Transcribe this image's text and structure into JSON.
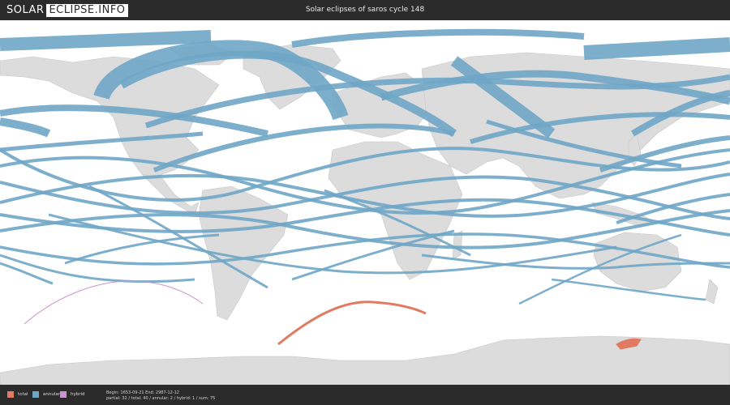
{
  "header": {
    "logo_part1": "SOLAR",
    "logo_part2": "ECLIPSE.INFO",
    "title": "Solar eclipses of saros cycle 148"
  },
  "colors": {
    "total": "#e07b62",
    "annular": "#6fa6c6",
    "hybrid": "#c994cc",
    "land": "#dcdcdc",
    "bar": "#2b2b2b"
  },
  "legend": [
    {
      "label": "total",
      "color": "#e07b62"
    },
    {
      "label": "annular",
      "color": "#6fa6c6"
    },
    {
      "label": "hybrid",
      "color": "#c994cc"
    }
  ],
  "footer": {
    "line1": "Begin: 1653-09-21 End: 2987-12-12",
    "line2": "partial: 32 / total: 40 / annular: 2 / hybrid: 1 / sum: 75"
  }
}
